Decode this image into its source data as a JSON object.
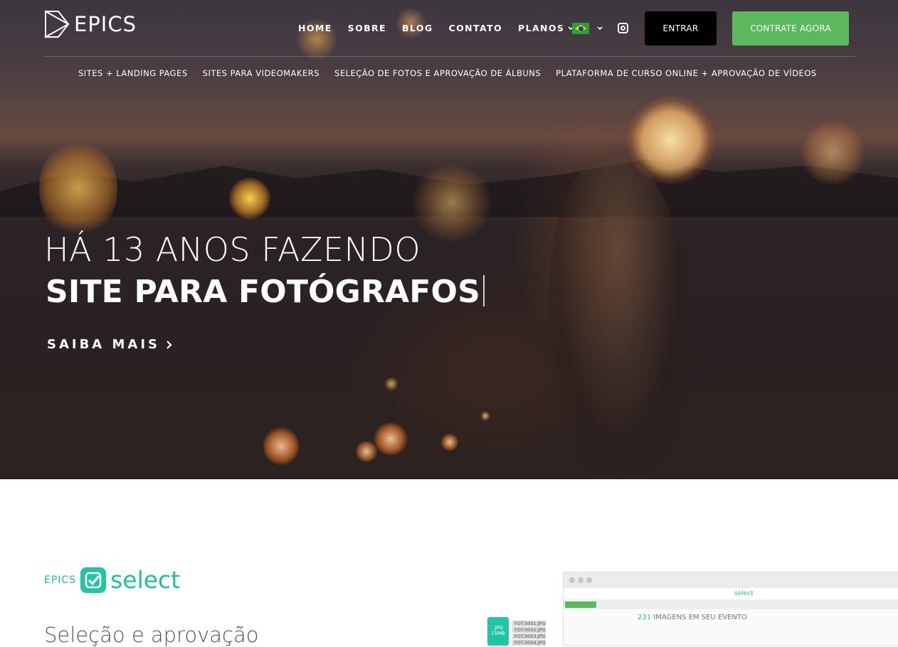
{
  "brand": {
    "logo_text": "EPICS"
  },
  "nav": {
    "items": [
      {
        "label": "HOME"
      },
      {
        "label": "SOBRE"
      },
      {
        "label": "BLOG"
      },
      {
        "label": "CONTATO"
      },
      {
        "label": "PLANOS",
        "has_dropdown": true
      }
    ],
    "language_flag": "brazil-flag-icon",
    "social_icon": "instagram-icon",
    "login_label": "ENTRAR",
    "cta_label": "CONTRATE AGORA"
  },
  "subnav": {
    "items": [
      {
        "label": "SITES + LANDING PAGES"
      },
      {
        "label": "SITES PARA VIDEOMAKERS"
      },
      {
        "label": "SELEÇÃO DE FOTOS E APROVAÇÃO DE ÁLBUNS"
      },
      {
        "label": "PLATAFORMA DE CURSO ONLINE + APROVAÇÃO DE VÍDEOS"
      }
    ]
  },
  "hero": {
    "line1": "HÁ 13 ANOS FAZENDO",
    "line2": "SITE PARA FOTÓGRAFOS",
    "cta": "SAIBA MAIS"
  },
  "product": {
    "logo_prefix": "EPICS",
    "logo_word": "select",
    "title": "Seleção e aprovação"
  },
  "illustration": {
    "file_type": ".JPG",
    "file_size": "15MB",
    "files": [
      "FOT.0001.JPG",
      "FOT.0002.JPG",
      "FOT.0003.JPG",
      "FOT.0004.JPG"
    ],
    "mock_logo": "select",
    "mock_count": "231",
    "mock_count_label": "IMAGENS EM SEU EVENTO"
  },
  "colors": {
    "accent_green": "#5cb85c",
    "teal": "#23c4a3",
    "button_dark": "#000000"
  }
}
